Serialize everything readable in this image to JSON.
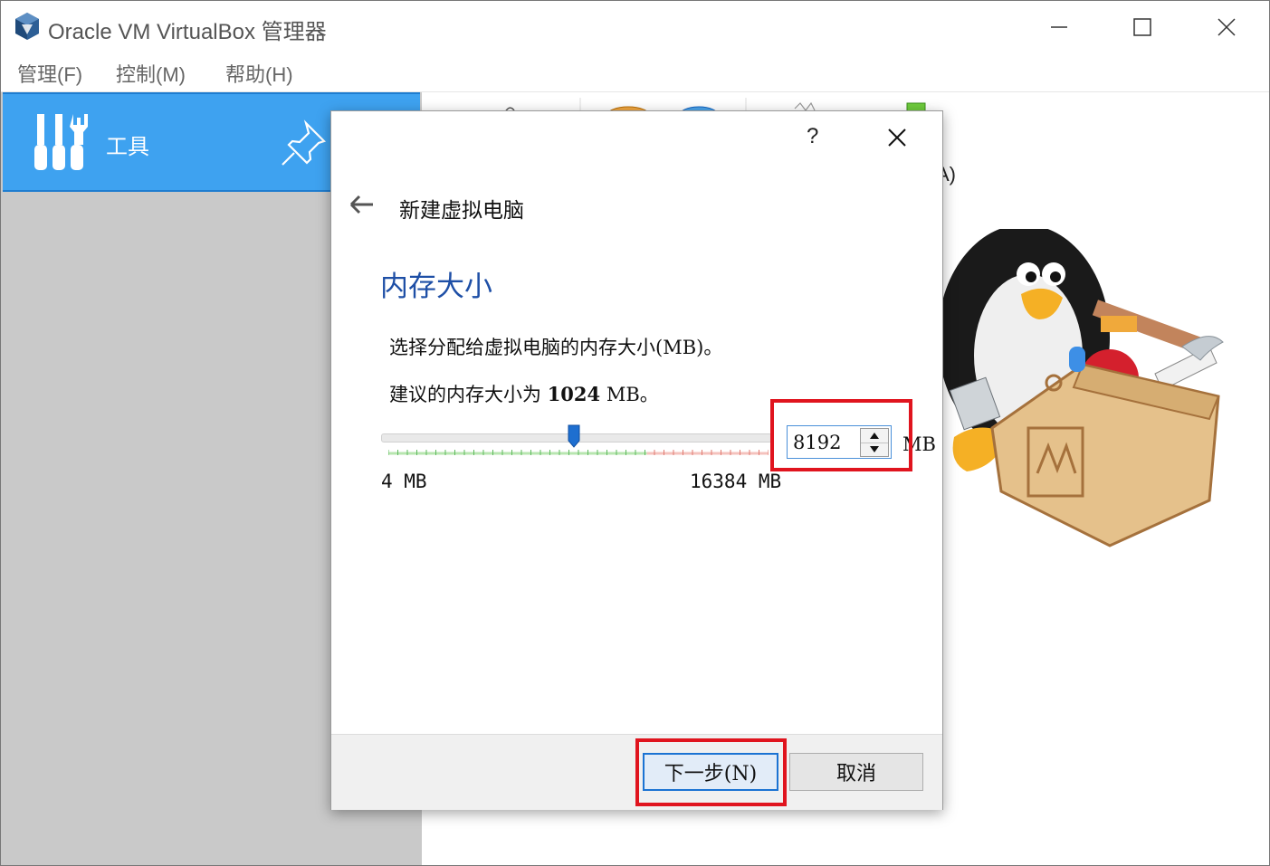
{
  "window": {
    "title": "Oracle VM VirtualBox 管理器",
    "controls": [
      "minimize",
      "maximize",
      "close"
    ]
  },
  "menubar": {
    "items": [
      {
        "label": "管理(F)"
      },
      {
        "label": "控制(M)"
      },
      {
        "label": "帮助(H)"
      }
    ]
  },
  "sidebar": {
    "tools_label": "工具",
    "icons": {
      "tools": "tools-icon",
      "pin": "pin-icon"
    }
  },
  "content": {
    "partial_text": "A)"
  },
  "dialog": {
    "help": "?",
    "title": "新建虚拟电脑",
    "page_heading": "内存大小",
    "description": "选择分配给虚拟电脑的内存大小(MB)。",
    "recommend_prefix": "建议的内存大小为 ",
    "recommend_value": "1024",
    "recommend_suffix": " MB。",
    "slider": {
      "min_label": "4 MB",
      "max_label": "16384 MB",
      "min": 4,
      "max": 16384,
      "value": 8192
    },
    "memory_value": "8192",
    "unit": "MB",
    "buttons": {
      "next": "下一步(N)",
      "cancel": "取消"
    }
  },
  "colors": {
    "accent": "#3ea2f0",
    "heading": "#1e4fa6",
    "highlight": "#e0141e"
  }
}
